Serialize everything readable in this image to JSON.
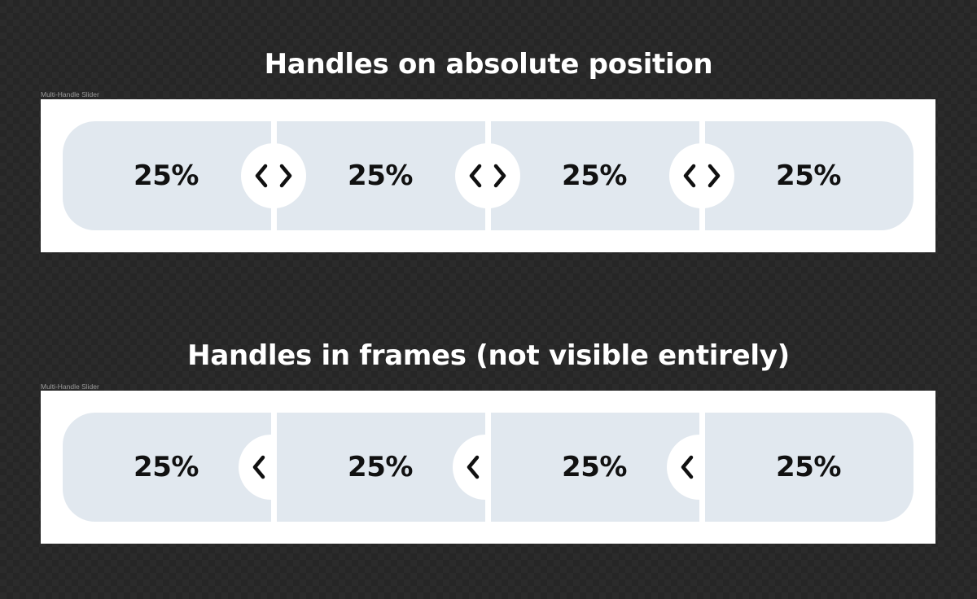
{
  "section_1": {
    "heading": "Handles on absolute position",
    "frame_label": "Multi-Handle Slider",
    "segments": [
      {
        "label": "25%",
        "value": 25
      },
      {
        "label": "25%",
        "value": 25
      },
      {
        "label": "25%",
        "value": 25
      },
      {
        "label": "25%",
        "value": 25
      }
    ],
    "handles": [
      {
        "icon": "chevrons-left-right-icon"
      },
      {
        "icon": "chevrons-left-right-icon"
      },
      {
        "icon": "chevrons-left-right-icon"
      }
    ]
  },
  "section_2": {
    "heading": "Handles in frames (not visible entirely)",
    "frame_label": "Multi-Handle Slider",
    "segments": [
      {
        "label": "25%",
        "value": 25
      },
      {
        "label": "25%",
        "value": 25
      },
      {
        "label": "25%",
        "value": 25
      },
      {
        "label": "25%",
        "value": 25
      }
    ],
    "handles": [
      {
        "icon": "chevron-left-icon"
      },
      {
        "icon": "chevron-left-icon"
      },
      {
        "icon": "chevron-left-icon"
      }
    ]
  },
  "colors": {
    "background": "#262626",
    "frame": "#ffffff",
    "segment": "#e1e8ef",
    "handle": "#ffffff",
    "text": "#111111",
    "heading": "#ffffff"
  }
}
